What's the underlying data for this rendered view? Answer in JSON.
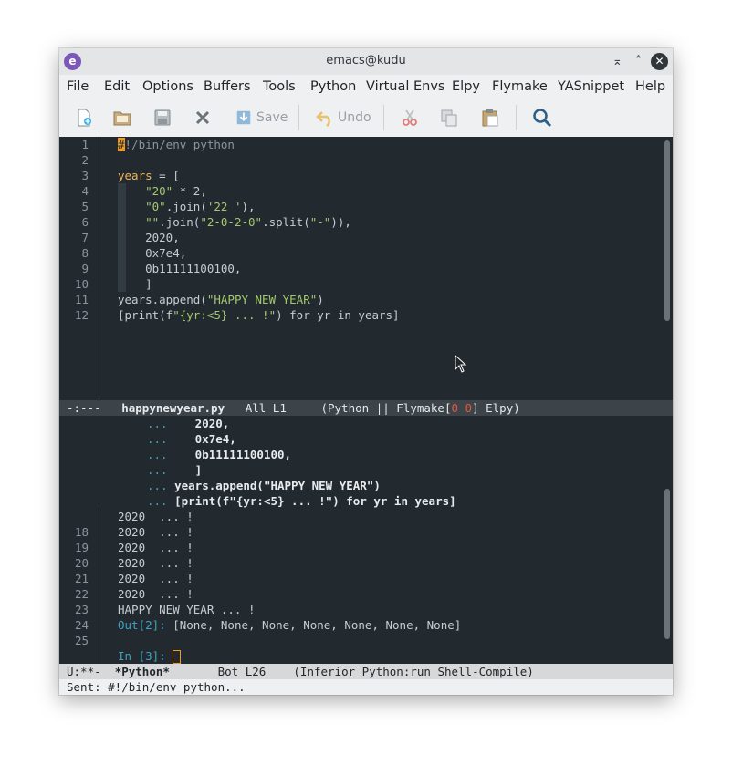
{
  "window": {
    "title": "emacs@kudu"
  },
  "menu": [
    "File",
    "Edit",
    "Options",
    "Buffers",
    "Tools",
    "Python",
    "Virtual Envs",
    "Elpy",
    "Flymake",
    "YASnippet",
    "Help"
  ],
  "toolbar": {
    "save_label": "Save",
    "undo_label": "Undo"
  },
  "editor": {
    "lines": [
      {
        "n": "1",
        "t": "#!/bin/env python"
      },
      {
        "n": "2",
        "t": ""
      },
      {
        "n": "3",
        "t": "years = ["
      },
      {
        "n": "4",
        "t": "    \"20\" * 2,"
      },
      {
        "n": "5",
        "t": "    \"0\".join('22 '),"
      },
      {
        "n": "6",
        "t": "    \"\".join(\"2-0-2-0\".split(\"-\")),"
      },
      {
        "n": "7",
        "t": "    2020,"
      },
      {
        "n": "8",
        "t": "    0x7e4,"
      },
      {
        "n": "9",
        "t": "    0b11111100100,"
      },
      {
        "n": "10",
        "t": "    ]"
      },
      {
        "n": "11",
        "t": "years.append(\"HAPPY NEW YEAR\")"
      },
      {
        "n": "12",
        "t": "[print(f\"{yr:<5} ... !\") for yr in years]"
      }
    ]
  },
  "modeline_editor": {
    "status": "-:---",
    "buffer": "happynewyear.py",
    "position": "All L1",
    "mode_prefix": "(Python || Flymake[",
    "flymake_errors": "0",
    "flymake_warnings": "0",
    "mode_suffix": "] Elpy)"
  },
  "shell": {
    "continuation": [
      {
        "p": "...",
        "t": "    2020,"
      },
      {
        "p": "...",
        "t": "    0x7e4,"
      },
      {
        "p": "...",
        "t": "    0b11111100100,"
      },
      {
        "p": "...",
        "t": "    ]"
      },
      {
        "p": "...",
        "t": "years.append(\"HAPPY NEW YEAR\")"
      },
      {
        "p": "...",
        "t": "[print(f\"{yr:<5} ... !\") for yr in years]"
      }
    ],
    "output": [
      {
        "n": "",
        "t": "2020  ... !"
      },
      {
        "n": "18",
        "t": "2020  ... !"
      },
      {
        "n": "19",
        "t": "2020  ... !"
      },
      {
        "n": "20",
        "t": "2020  ... !"
      },
      {
        "n": "21",
        "t": "2020  ... !"
      },
      {
        "n": "22",
        "t": "2020  ... !"
      },
      {
        "n": "23",
        "t": "HAPPY NEW YEAR ... !"
      }
    ],
    "out_line": {
      "n": "24",
      "label": "Out[2]:",
      "value": " [None, None, None, None, None, None, None]"
    },
    "blank_line": {
      "n": "25"
    },
    "in_prompt": "In [3]: "
  },
  "modeline_shell": {
    "status": "U:**-",
    "buffer": "*Python*",
    "position": "Bot L26",
    "mode": "(Inferior Python:run Shell-Compile)"
  },
  "echo_area": "Sent: #!/bin/env python...",
  "colors": {
    "bg": "#232a2f",
    "string": "#a3c96c",
    "prompt": "#3fa3c2",
    "flymake": "#e0583f"
  }
}
